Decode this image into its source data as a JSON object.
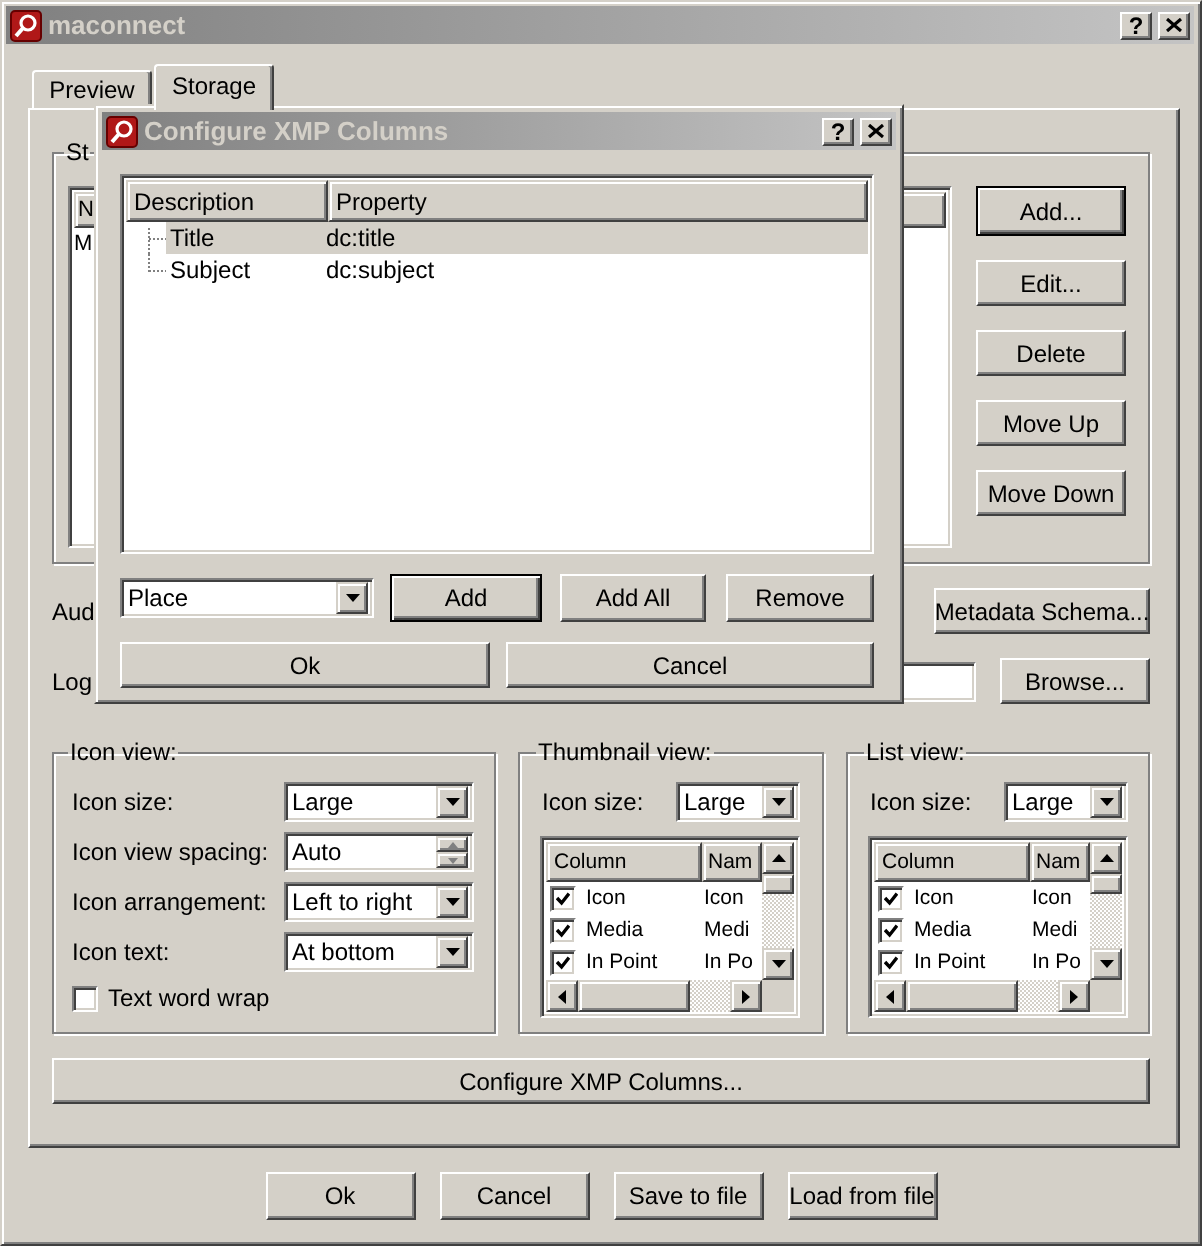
{
  "window": {
    "title": "maconnect",
    "help": "?"
  },
  "tabs": [
    {
      "label": "Preview",
      "selected": false
    },
    {
      "label": "Storage",
      "selected": true
    }
  ],
  "storage": {
    "group_label": "St",
    "list_header": "N",
    "list_rows": [
      "M"
    ],
    "buttons": [
      {
        "label": "Add...",
        "default": true
      },
      {
        "label": "Edit...",
        "default": false
      },
      {
        "label": "Delete",
        "default": false
      },
      {
        "label": "Move Up",
        "default": false
      },
      {
        "label": "Move Down",
        "default": false
      }
    ]
  },
  "audio_label": "Aud",
  "metadata_button": "Metadata Schema...",
  "log_label": "Log",
  "browse_button": "Browse...",
  "icon_view": {
    "title": "Icon view:",
    "settings": [
      {
        "label": "Icon size:",
        "kind": "dropdown",
        "value": "Large"
      },
      {
        "label": "Icon view spacing:",
        "kind": "spinner",
        "value": "Auto"
      },
      {
        "label": "Icon arrangement:",
        "kind": "dropdown",
        "value": "Left to right"
      },
      {
        "label": "Icon text:",
        "kind": "dropdown",
        "value": "At bottom"
      }
    ],
    "word_wrap": {
      "label": "Text word wrap",
      "checked": false
    }
  },
  "thumbnail_view": {
    "title": "Thumbnail view:",
    "icon_size_label": "Icon size:",
    "icon_size": "Large",
    "columns": [
      "Column",
      "Nam"
    ],
    "rows": [
      {
        "column": "Icon",
        "name": "Icon",
        "checked": true
      },
      {
        "column": "Media",
        "name": "Medi",
        "checked": true
      },
      {
        "column": "In Point",
        "name": "In Po",
        "checked": true
      }
    ]
  },
  "list_view": {
    "title": "List view:",
    "icon_size_label": "Icon size:",
    "icon_size": "Large",
    "columns": [
      "Column",
      "Nam"
    ],
    "rows": [
      {
        "column": "Icon",
        "name": "Icon",
        "checked": true
      },
      {
        "column": "Media",
        "name": "Medi",
        "checked": true
      },
      {
        "column": "In Point",
        "name": "In Po",
        "checked": true
      }
    ]
  },
  "configure_button": "Configure XMP Columns...",
  "footer_buttons": [
    "Ok",
    "Cancel",
    "Save to file",
    "Load from file"
  ],
  "dialog": {
    "title": "Configure XMP Columns",
    "help": "?",
    "columns": [
      "Description",
      "Property"
    ],
    "rows": [
      {
        "description": "Title",
        "property": "dc:title",
        "selected": true
      },
      {
        "description": "Subject",
        "property": "dc:subject",
        "selected": false
      }
    ],
    "combo": "Place",
    "buttons": [
      {
        "label": "Add",
        "default": true
      },
      {
        "label": "Add All",
        "default": false
      },
      {
        "label": "Remove",
        "default": false
      }
    ],
    "ok": "Ok",
    "cancel": "Cancel"
  }
}
